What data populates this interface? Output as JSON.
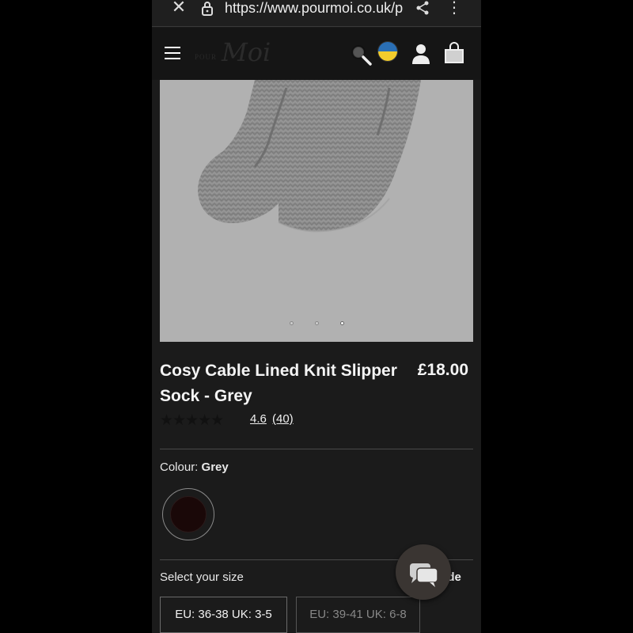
{
  "browser": {
    "url": "https://www.pourmoi.co.uk/p",
    "close_icon": "close-icon",
    "lock_icon": "lock-icon",
    "share_icon": "share-icon",
    "menu_icon": "more-vert-icon"
  },
  "header": {
    "logo_small": "POUR",
    "logo_script": "Moi",
    "icons": [
      "menu-icon",
      "search-icon",
      "ukraine-flag-icon",
      "account-icon",
      "bag-icon"
    ]
  },
  "gallery": {
    "dots": 3,
    "active_dot": 3
  },
  "product": {
    "title": "Cosy Cable Lined Knit Slipper Sock - Grey",
    "price": "£18.00",
    "stars": "★★★★★",
    "rating": "4.6",
    "reviews": "(40)"
  },
  "colour": {
    "label": "Colour:",
    "value": "Grey",
    "swatch_color": "#1a0808"
  },
  "size": {
    "label": "Select your size",
    "guide": "uide",
    "options": [
      "EU: 36-38 UK: 3-5",
      "EU: 39-41 UK: 6-8"
    ]
  },
  "chat": {
    "icon": "chat-icon"
  },
  "colors": {
    "background": "#1b1b1b",
    "image_bg": "#b1b1b1",
    "text": "#f4f4f4"
  }
}
